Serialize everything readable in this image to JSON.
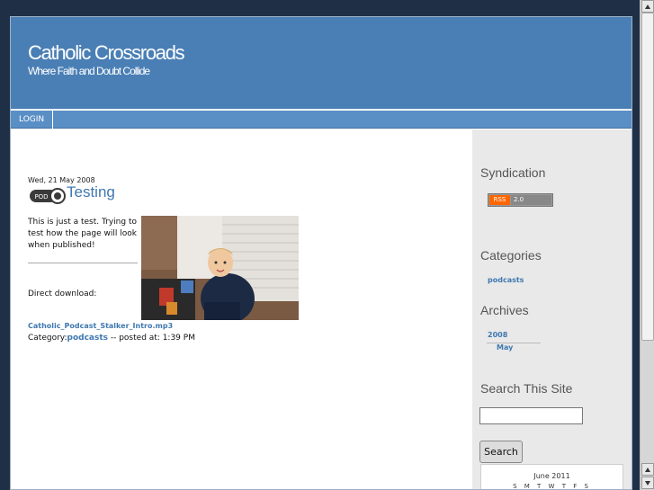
{
  "header": {
    "title": "Catholic Crossroads",
    "tagline": "Where Faith and Doubt Collide"
  },
  "nav": {
    "login": "LOGIN"
  },
  "post": {
    "date": "Wed, 21 May 2008",
    "icon_label": "POD",
    "title": "Testing",
    "body": "This is just a test.  Trying to test how the page will look when published!",
    "download_label": "Direct download:",
    "download_file": "Catholic_Podcast_Stalker_Intro.mp3",
    "category_prefix": "Category:",
    "category": "podcasts",
    "posted_at": " -- posted at: 1:39 PM"
  },
  "sidebar": {
    "syndication_heading": "Syndication",
    "rss_left": "RSS",
    "rss_right": "2.0",
    "categories_heading": "Categories",
    "category_link": "podcasts",
    "archives_heading": "Archives",
    "archive_year": "2008",
    "archive_month": "May",
    "search_heading": "Search This Site",
    "search_value": "",
    "search_button": "Search",
    "calendar_title": "June 2011",
    "calendar_days": "S M T W T F S"
  },
  "colors": {
    "header_bg": "#4a7fb5",
    "link": "#3f78b0",
    "page_bg": "#1f2f45"
  },
  "icons": [
    "pod-icon",
    "scroll-up-icon",
    "scroll-down-icon"
  ]
}
